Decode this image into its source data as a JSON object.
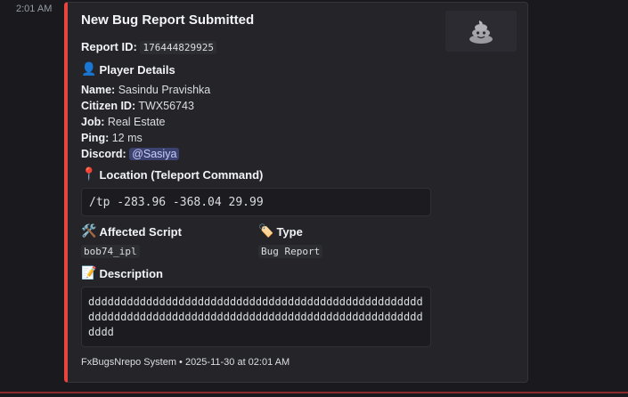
{
  "message": {
    "timestamp": "2:01 AM"
  },
  "embed": {
    "accent_color": "#e8453c",
    "title": "New Bug Report Submitted",
    "thumbnail_icon": "poop-icon",
    "report_id_label": "Report ID:",
    "report_id_value": "176444829925",
    "player_section": {
      "emoji": "👤",
      "title": "Player Details",
      "rows": [
        {
          "label": "Name:",
          "value": "Sasindu Pravishka"
        },
        {
          "label": "Citizen ID:",
          "value": "TWX56743"
        },
        {
          "label": "Job:",
          "value": "Real Estate"
        },
        {
          "label": "Ping:",
          "value": "12 ms"
        }
      ],
      "discord_label": "Discord:",
      "discord_mention": "@Sasiya"
    },
    "location_section": {
      "emoji": "📍",
      "title": "Location (Teleport Command)",
      "command": "/tp -283.96 -368.04 29.99"
    },
    "fields": [
      {
        "emoji": "🛠️",
        "name": "Affected Script",
        "value": "bob74_ipl"
      },
      {
        "emoji": "🏷️",
        "name": "Type",
        "value": "Bug Report"
      }
    ],
    "description_section": {
      "emoji": "📝",
      "title": "Description",
      "text": "dddddddddddddddddddddddddddddddddddddddddddddddddddddddddddddddddddddddddddddddddddddddddddddddddddddddddddd"
    },
    "footer": "FxBugsNrepo System • 2025-11-30 at 02:01 AM"
  }
}
